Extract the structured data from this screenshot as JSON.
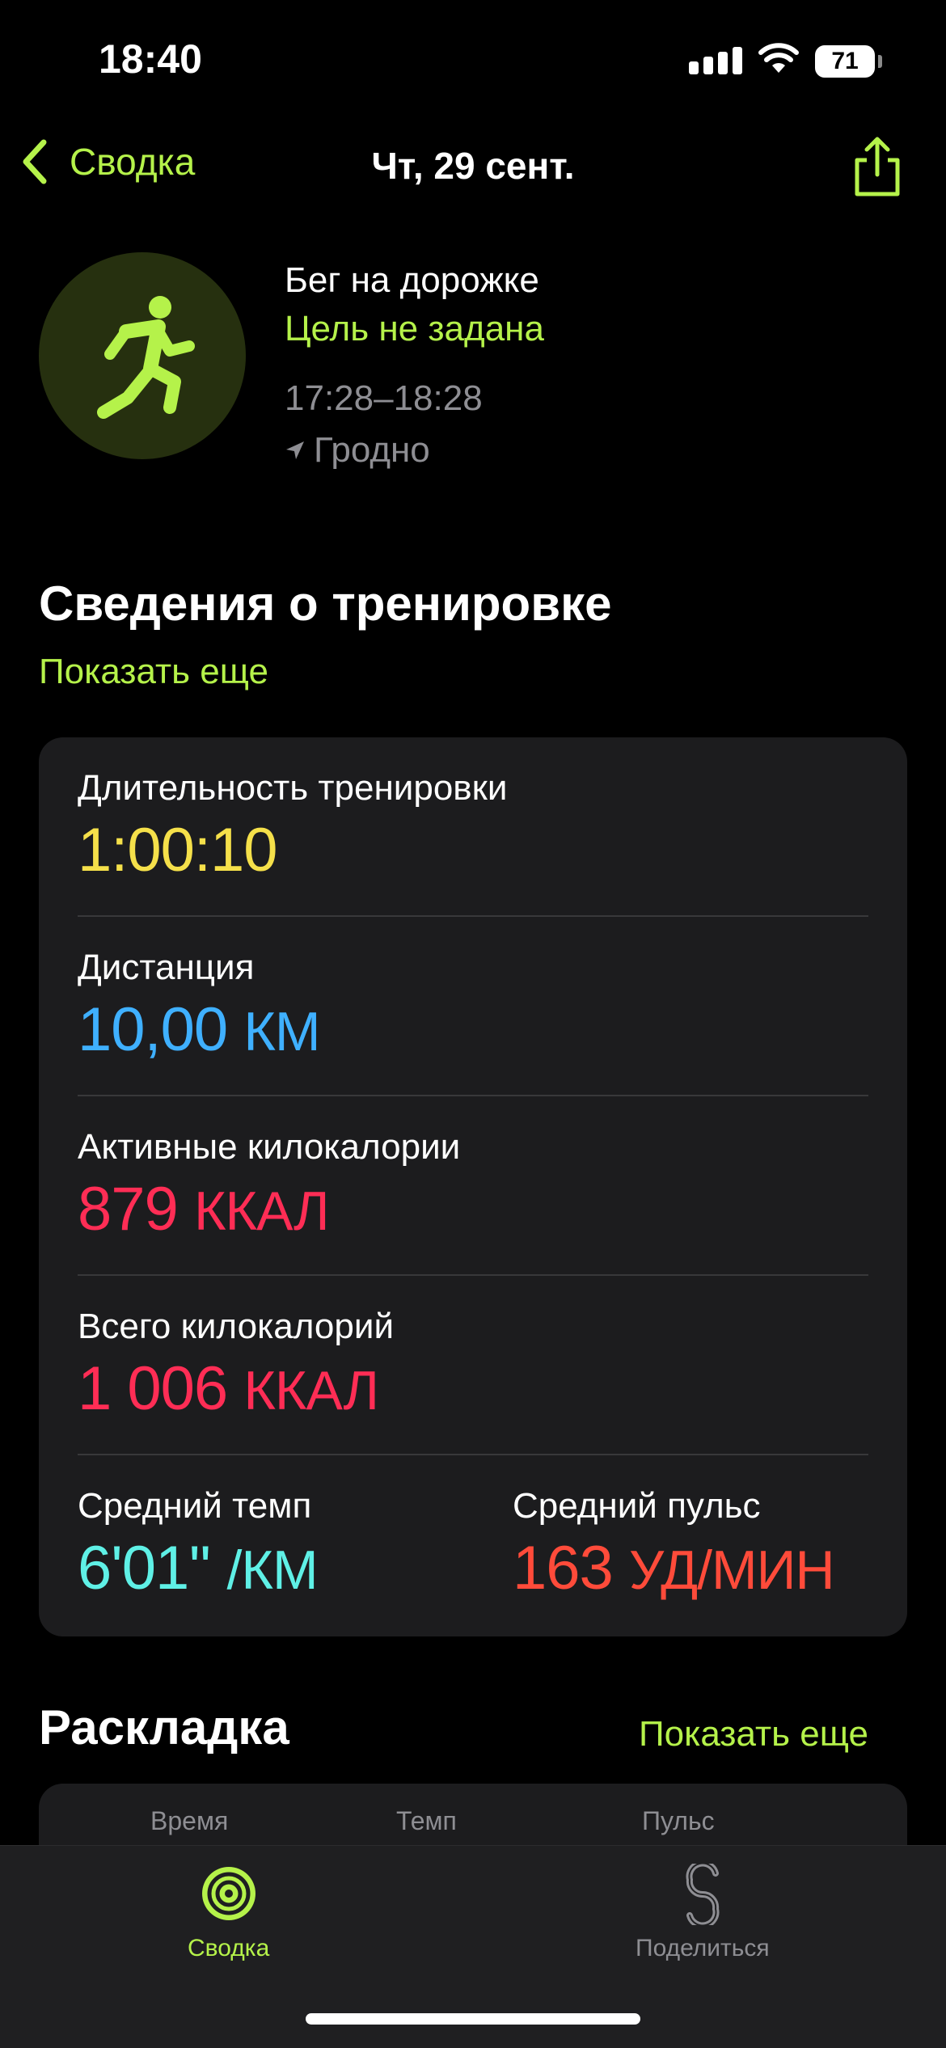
{
  "status": {
    "time": "18:40",
    "battery": "71"
  },
  "nav": {
    "back_label": "Сводка",
    "title": "Чт, 29 сент."
  },
  "workout": {
    "name": "Бег на дорожке",
    "goal": "Цель не задана",
    "time_range": "17:28–18:28",
    "location": "Гродно"
  },
  "details": {
    "title": "Сведения о тренировке",
    "show_more": "Показать еще",
    "duration": {
      "label": "Длительность тренировки",
      "value": "1:00:10"
    },
    "distance": {
      "label": "Дистанция",
      "value": "10,00",
      "unit": "КМ"
    },
    "active_kcal": {
      "label": "Активные килокалории",
      "value": "879",
      "unit": "ККАЛ"
    },
    "total_kcal": {
      "label": "Всего килокалорий",
      "value": "1 006",
      "unit": "ККАЛ"
    },
    "pace": {
      "label": "Средний темп",
      "value": "6'01''",
      "unit": "/КМ"
    },
    "heart_rate": {
      "label": "Средний пульс",
      "value": "163",
      "unit": "УД/МИН"
    }
  },
  "splits": {
    "title": "Раскладка",
    "show_more": "Показать еще",
    "columns": [
      "Время",
      "Темп",
      "Пульс"
    ]
  },
  "tabbar": {
    "summary": "Сводка",
    "share": "Поделиться"
  },
  "colors": {
    "accent": "#b5f24a",
    "duration": "#f5e04a",
    "distance": "#3fb0ff",
    "calories": "#ff2d55",
    "pace": "#5ff0e6",
    "heart_rate": "#ff4b3a"
  }
}
